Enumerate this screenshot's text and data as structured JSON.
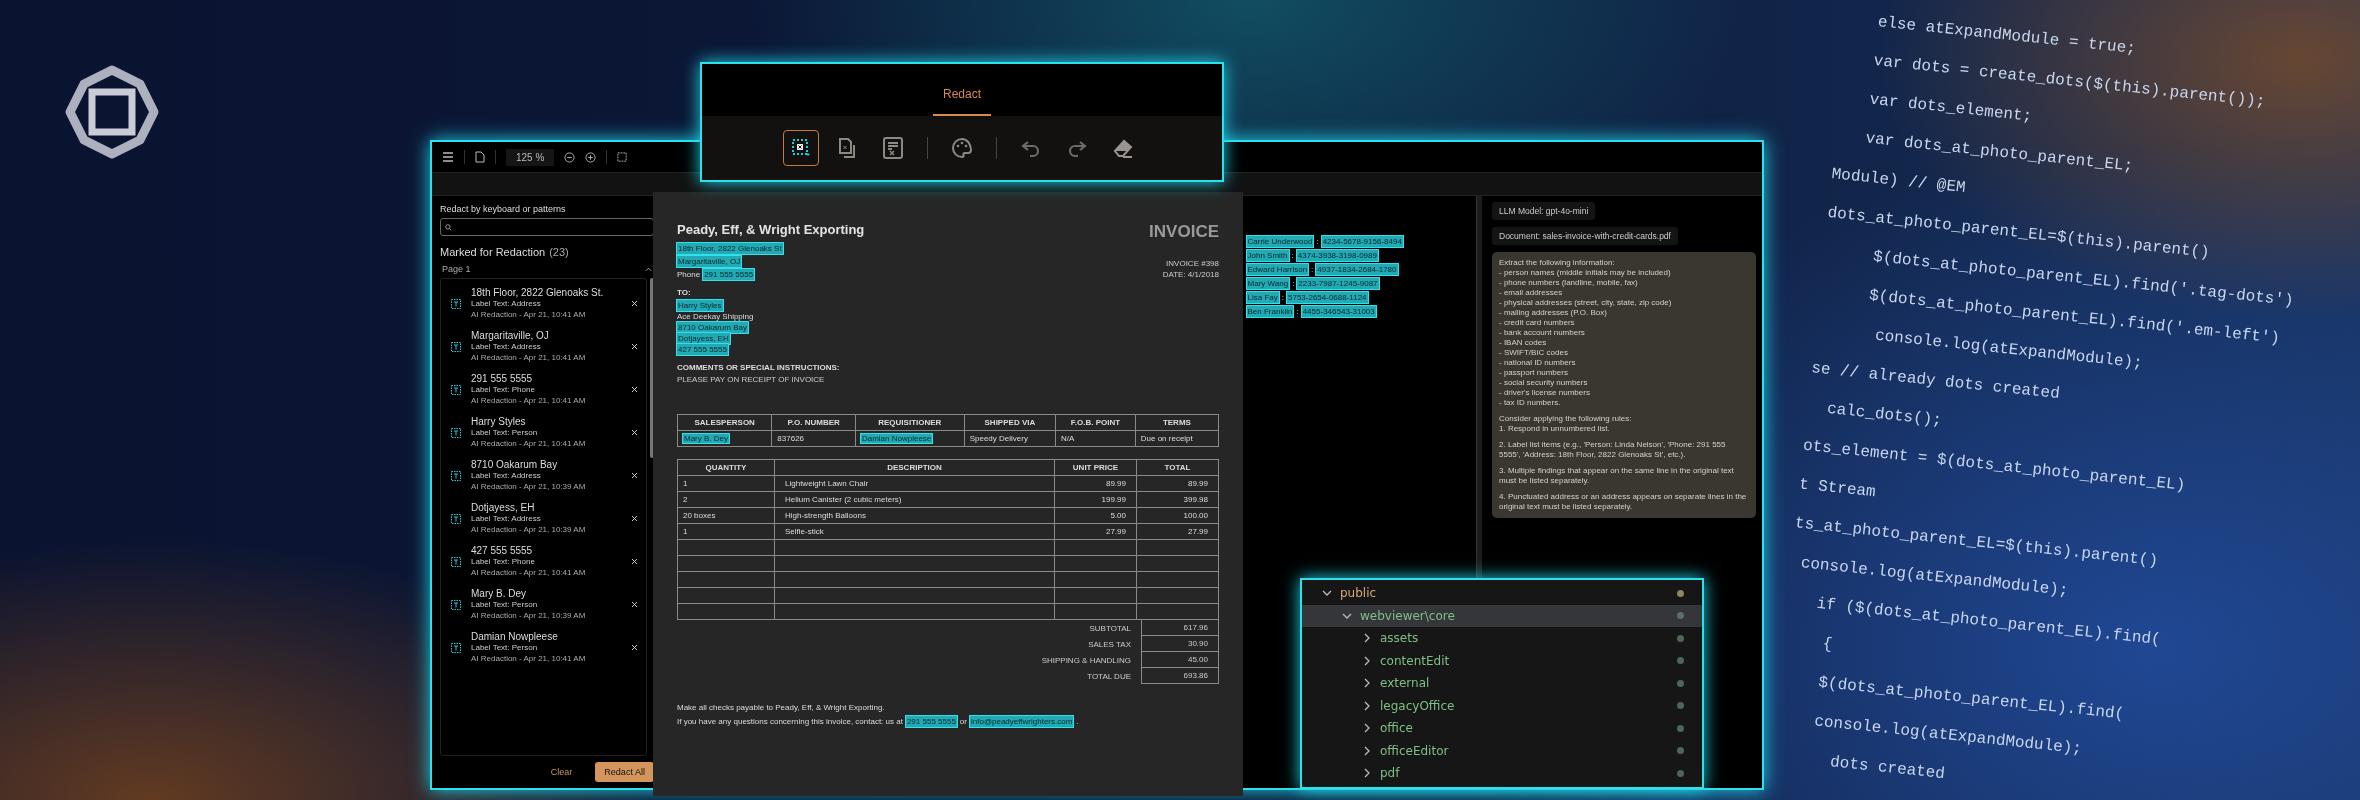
{
  "viewer": {
    "header": {
      "zoom": "125 %"
    },
    "redaction_panel": {
      "search_label": "Redact by keyboard or patterns",
      "title": "Marked for Redaction",
      "count": "(23)",
      "page_label": "Page 1",
      "items": [
        {
          "text": "18th Floor, 2822 Glenoaks St.",
          "label": "Label Text: Address",
          "meta": "AI Redaction - Apr 21, 10:41 AM"
        },
        {
          "text": "Margaritaville, OJ",
          "label": "Label Text: Address",
          "meta": "AI Redaction - Apr 21, 10:41 AM"
        },
        {
          "text": "291 555 5555",
          "label": "Label Text: Phone",
          "meta": "AI Redaction - Apr 21, 10:41 AM"
        },
        {
          "text": "Harry Styles",
          "label": "Label Text: Person",
          "meta": "AI Redaction - Apr 21, 10:41 AM"
        },
        {
          "text": "8710 Oakarum Bay",
          "label": "Label Text: Address",
          "meta": "AI Redaction - Apr 21, 10:39 AM"
        },
        {
          "text": "Dotjayess, EH",
          "label": "Label Text: Address",
          "meta": "AI Redaction - Apr 21, 10:39 AM"
        },
        {
          "text": "427 555 5555",
          "label": "Label Text: Phone",
          "meta": "AI Redaction - Apr 21, 10:41 AM"
        },
        {
          "text": "Mary B. Dey",
          "label": "Label Text: Person",
          "meta": "AI Redaction - Apr 21, 10:39 AM"
        },
        {
          "text": "Damian Nowpleese",
          "label": "Label Text: Person",
          "meta": "AI Redaction - Apr 21, 10:41 AM"
        }
      ],
      "buttons": [
        {
          "label": "Clear",
          "kind": "text"
        },
        {
          "label": "Redact All",
          "kind": "primary"
        }
      ]
    },
    "invoice": {
      "company": "Peady, Eff, & Wright Exporting",
      "title": "INVOICE",
      "header_lines": [
        [
          {
            "text": "18th Floor, 2822 Glenoaks St",
            "marked": true
          }
        ],
        [
          {
            "text": "Margaritaville, OJ",
            "marked": true
          }
        ],
        [
          {
            "text": "Phone",
            "marked": false
          },
          {
            "text": "291 555 5555",
            "marked": true
          }
        ]
      ],
      "meta_lines": [
        "INVOICE #398",
        "DATE: 4/1/2018"
      ],
      "to_label": "TO:",
      "to_lines": [
        [
          {
            "text": "Harry Styles",
            "marked": true
          }
        ],
        [
          {
            "text": "Ace Deekay Shipping",
            "marked": false
          }
        ],
        [
          {
            "text": "8710 Oakarum Bay",
            "marked": true
          }
        ],
        [
          {
            "text": "Dotjayess, EH",
            "marked": true
          }
        ],
        [
          {
            "text": "427 555 5555",
            "marked": true
          }
        ]
      ],
      "comments_label": "COMMENTS OR SPECIAL INSTRUCTIONS:",
      "comments": "PLEASE PAY ON RECEIPT OF INVOICE",
      "order_table": {
        "columns": [
          "SALESPERSON",
          "P.O. NUMBER",
          "REQUISITIONER",
          "SHIPPED VIA",
          "F.O.B. POINT",
          "TERMS"
        ],
        "row": [
          {
            "text": "Mary B. Dey",
            "marked": true
          },
          {
            "text": "837626",
            "marked": false
          },
          {
            "text": "Damian Nowpleese",
            "marked": true
          },
          {
            "text": "Speedy Delivery",
            "marked": false
          },
          {
            "text": "N/A",
            "marked": false
          },
          {
            "text": "Due on receipt",
            "marked": false
          }
        ]
      },
      "items_table": {
        "columns": [
          "QUANTITY",
          "DESCRIPTION",
          "UNIT PRICE",
          "TOTAL"
        ],
        "rows": [
          [
            "1",
            "Lightweight Lawn Chair",
            "89.99",
            "89.99"
          ],
          [
            "2",
            "Helium Canister (2 cubic meters)",
            "199.99",
            "399.98"
          ],
          [
            "20 boxes",
            "High-strength Balloons",
            "5.00",
            "100.00"
          ],
          [
            "1",
            "Selfie-stick",
            "27.99",
            "27.99"
          ]
        ]
      },
      "totals": [
        {
          "label": "SUBTOTAL",
          "value": "617.96"
        },
        {
          "label": "SALES TAX",
          "value": "30.90"
        },
        {
          "label": "SHIPPING & HANDLING",
          "value": "45.00"
        },
        {
          "label": "TOTAL DUE",
          "value": "693.86"
        }
      ],
      "footer_lines": [
        [
          {
            "text": "Make all checks payable to Peady, Eff, & Wright Exporting.",
            "marked": false
          }
        ],
        [
          {
            "text": "If you have any questions concerning this invoice, contact: us at",
            "marked": false
          },
          {
            "text": "291 555 5555",
            "marked": true
          },
          {
            "text": "or",
            "marked": false
          },
          {
            "text": "info@peadyeffwrighters.com",
            "marked": true
          },
          {
            "text": ".",
            "marked": false
          }
        ]
      ]
    },
    "extracted_lines": [
      [
        {
          "text": "Carrie Underwood",
          "marked": true
        },
        {
          "text": ":",
          "marked": false
        },
        {
          "text": "4234-5678-9156-8494",
          "marked": true
        }
      ],
      [
        {
          "text": "John Smith",
          "marked": true
        },
        {
          "text": ":",
          "marked": false
        },
        {
          "text": "4374-3938-3198-0989",
          "marked": true
        }
      ],
      [
        {
          "text": "Edward Harrison",
          "marked": true
        },
        {
          "text": ":",
          "marked": false
        },
        {
          "text": "4937-1834-2684-1780",
          "marked": true
        }
      ],
      [
        {
          "text": "Mary Wang",
          "marked": true
        },
        {
          "text": ":",
          "marked": false
        },
        {
          "text": "2233-7987-1245-9087",
          "marked": true
        }
      ],
      [
        {
          "text": "Lisa Fay",
          "marked": true
        },
        {
          "text": ":",
          "marked": false
        },
        {
          "text": "5753-2654-0688-1124",
          "marked": true
        }
      ],
      [
        {
          "text": "Ben Franklin",
          "marked": true
        },
        {
          "text": ":",
          "marked": false
        },
        {
          "text": "4455-346543-31003",
          "marked": true
        }
      ]
    ],
    "llm_panel": {
      "model": "LLM Model: gpt-4o-mini",
      "document": "Document: sales-invoice-with-credit-cards.pdf",
      "prompt_blocks": [
        [
          "Extract the following information:",
          "- person names (middle initials may be included)",
          "- phone numbers (landline, mobile, fax)",
          "- email addresses",
          "- physical addresses (street, city, state, zip code)",
          "- mailing addresses (P.O. Box)",
          "- credit card numbers",
          "- bank account numbers",
          "- IBAN codes",
          "- SWIFT/BIC codes",
          "- national ID numbers",
          "- passport numbers",
          "- social security numbers",
          "- driver's license numbers",
          "- tax ID numbers."
        ],
        [
          "Consider applying the following rules:",
          "1. Respond in unnumbered list."
        ],
        [
          "2. Label list items (e.g., 'Person: Linda Nelson', 'Phone: 291 555 5555', 'Address: 18th Floor, 2822 Glenoaks St', etc.)."
        ],
        [
          "3. Multiple findings that appear on the same line in the original text must be listed separately."
        ],
        [
          "4. Punctuated address or an address appears on separate lines in the original text must be listed separately."
        ]
      ]
    }
  },
  "redact_popup": {
    "tabs": [
      {
        "label": "Redact",
        "selected": true
      }
    ],
    "tool_groups": [
      [
        {
          "kind": "marquee",
          "selected": true
        },
        {
          "kind": "page",
          "selected": false
        },
        {
          "kind": "panel",
          "selected": false
        }
      ],
      [
        {
          "kind": "palette",
          "selected": false
        }
      ],
      [
        {
          "kind": "undo",
          "selected": false
        },
        {
          "kind": "redo",
          "selected": false
        },
        {
          "kind": "eraser",
          "selected": false
        }
      ]
    ]
  },
  "file_tree": {
    "items": [
      {
        "name": "public",
        "expanded": true,
        "selected": false,
        "color": "#8c8560",
        "children": [
          {
            "name": "webviewer\\core",
            "expanded": true,
            "selected": true,
            "color": "#5d6e66",
            "children": [
              {
                "name": "assets",
                "expanded": false,
                "selected": false,
                "color": "#4d6656"
              },
              {
                "name": "contentEdit",
                "expanded": false,
                "selected": false,
                "color": "#4d6656"
              },
              {
                "name": "external",
                "expanded": false,
                "selected": false,
                "color": "#4d6656"
              },
              {
                "name": "legacyOffice",
                "expanded": false,
                "selected": false,
                "color": "#4d6656"
              },
              {
                "name": "office",
                "expanded": false,
                "selected": false,
                "color": "#4d6656"
              },
              {
                "name": "officeEditor",
                "expanded": false,
                "selected": false,
                "color": "#4d6656"
              },
              {
                "name": "pdf",
                "expanded": false,
                "selected": false,
                "color": "#4d6656"
              }
            ]
          }
        ]
      }
    ]
  },
  "background_code": [
    "else atExpandModule = true;",
    "var dots = create_dots($(this).parent());",
    "var dots_element;",
    "var dots_at_photo_parent_EL;",
    "Module) // @EM",
    "dots_at_photo_parent_EL=$(this).parent()",
    "$(dots_at_photo_parent_EL).find('.tag-dots')",
    "$(dots_at_photo_parent_EL).find('.em-left')",
    "console.log(atExpandModule);",
    "se // already dots created",
    "calc_dots();",
    "ots_element = $(dots_at_photo_parent_EL)",
    "t Stream",
    "ts_at_photo_parent_EL=$(this).parent()",
    "console.log(atExpandModule);",
    "if ($(dots_at_photo_parent_EL).find(",
    "{",
    "$(dots_at_photo_parent_EL).find(",
    "console.log(atExpandModule);",
    "dots created"
  ]
}
